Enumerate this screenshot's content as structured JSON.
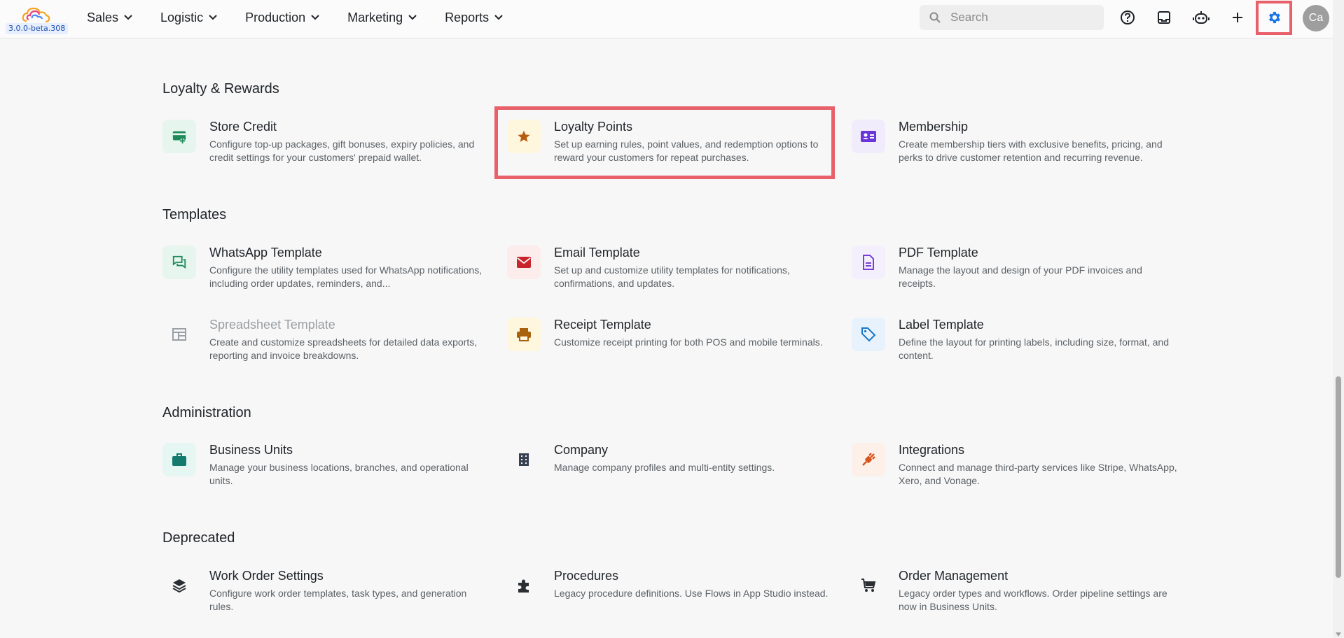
{
  "app": {
    "version": "3.0.0-beta.308"
  },
  "nav": {
    "items": [
      "Sales",
      "Logistic",
      "Production",
      "Marketing",
      "Reports"
    ]
  },
  "search": {
    "placeholder": "Search"
  },
  "header_icons": [
    "help-circle-icon",
    "inbox-icon",
    "robot-icon",
    "plus-icon",
    "settings-gear-icon"
  ],
  "avatar": {
    "initials": "Ca"
  },
  "colors": {
    "highlight": "#e8606a",
    "accent_blue": "#1a73e8"
  },
  "sections": [
    {
      "title": "Loyalty & Rewards",
      "cards": [
        {
          "title": "Store Credit",
          "desc": "Configure top-up packages, gift bonuses, expiry policies, and credit settings for your customers' prepaid wallet.",
          "icon": "wallet-add-icon",
          "icon_color": "#1e8a5a",
          "bg": "#e6f6ee"
        },
        {
          "title": "Loyalty Points",
          "desc": "Set up earning rules, point values, and redemption options to reward your customers for repeat purchases.",
          "icon": "star-icon",
          "icon_color": "#b85c12",
          "bg": "#fff6de"
        },
        {
          "title": "Membership",
          "desc": "Create membership tiers with exclusive benefits, pricing, and perks to drive customer retention and recurring revenue.",
          "icon": "id-card-icon",
          "icon_color": "#6a35d9",
          "bg": "#f1ecfc"
        }
      ]
    },
    {
      "title": "Templates",
      "cards": [
        {
          "title": "WhatsApp Template",
          "desc": "Configure the utility templates used for WhatsApp notifications, including order updates, reminders, and...",
          "icon": "chat-bubbles-icon",
          "icon_color": "#1e8a5a",
          "bg": "#e6f6ee"
        },
        {
          "title": "Email Template",
          "desc": "Set up and customize utility templates for notifications, confirmations, and updates.",
          "icon": "envelope-icon",
          "icon_color": "#c8242c",
          "bg": "#fdecec"
        },
        {
          "title": "PDF Template",
          "desc": "Manage the layout and design of your PDF invoices and receipts.",
          "icon": "document-icon",
          "icon_color": "#7a3fd6",
          "bg": "#f4effc"
        },
        {
          "title": "Spreadsheet Template",
          "desc": "Create and customize spreadsheets for detailed data exports, reporting and invoice breakdowns.",
          "icon": "table-icon",
          "icon_color": "#9aa0a6",
          "bg": "transparent",
          "disabled": true
        },
        {
          "title": "Receipt Template",
          "desc": "Customize receipt printing for both POS and mobile terminals.",
          "icon": "printer-icon",
          "icon_color": "#a8620e",
          "bg": "#fff6de"
        },
        {
          "title": "Label Template",
          "desc": "Define the layout for printing labels, including size, format, and content.",
          "icon": "tag-icon",
          "icon_color": "#1677c9",
          "bg": "#e8f2fc"
        }
      ]
    },
    {
      "title": "Administration",
      "cards": [
        {
          "title": "Business Units",
          "desc": "Manage your business locations, branches, and operational units.",
          "icon": "briefcase-icon",
          "icon_color": "#157a6e",
          "bg": "#e6f6f2"
        },
        {
          "title": "Company",
          "desc": "Manage company profiles and multi-entity settings.",
          "icon": "building-icon",
          "icon_color": "#374151",
          "bg": "transparent"
        },
        {
          "title": "Integrations",
          "desc": "Connect and manage third-party services like Stripe, WhatsApp, Xero, and Vonage.",
          "icon": "plug-icon",
          "icon_color": "#d9541e",
          "bg": "#fdf0e8"
        }
      ]
    },
    {
      "title": "Deprecated",
      "cards": [
        {
          "title": "Work Order Settings",
          "desc": "Configure work order templates, task types, and generation rules.",
          "icon": "layers-icon",
          "icon_color": "#2b2f33",
          "bg": "transparent"
        },
        {
          "title": "Procedures",
          "desc": "Legacy procedure definitions. Use Flows in App Studio instead.",
          "icon": "puzzle-icon",
          "icon_color": "#2b2f33",
          "bg": "transparent"
        },
        {
          "title": "Order Management",
          "desc": "Legacy order types and workflows. Order pipeline settings are now in Business Units.",
          "icon": "cart-icon",
          "icon_color": "#2b2f33",
          "bg": "transparent"
        }
      ]
    }
  ]
}
